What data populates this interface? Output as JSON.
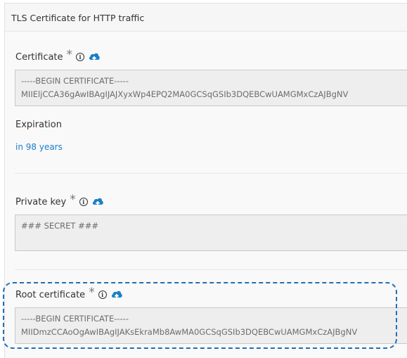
{
  "panel": {
    "title": "TLS Certificate for HTTP traffic"
  },
  "certificate": {
    "label": "Certificate",
    "required_marker": "*",
    "value_line1": "-----BEGIN CERTIFICATE-----",
    "value_line2": "MIIEljCCA36gAwIBAgIJAJXyxWp4EPQ2MA0GCSqGSIb3DQEBCwUAMGMxCzAJBgNV"
  },
  "expiration": {
    "label": "Expiration",
    "value": "in 98 years"
  },
  "private_key": {
    "label": "Private key",
    "required_marker": "*",
    "value": "### SECRET ###"
  },
  "root_certificate": {
    "label": "Root certificate",
    "required_marker": "*",
    "value_line1": "-----BEGIN CERTIFICATE-----",
    "value_line2": "MIIDmzCCAoOgAwIBAgIJAKsEkraMb8AwMA0GCSqGSIb3DQEBCwUAMGMxCzAJBgNV"
  },
  "colors": {
    "accent_blue": "#1a7fc7",
    "highlight_dash": "#1f6fb5"
  },
  "icons": [
    "info-icon",
    "cloud-upload-icon"
  ]
}
